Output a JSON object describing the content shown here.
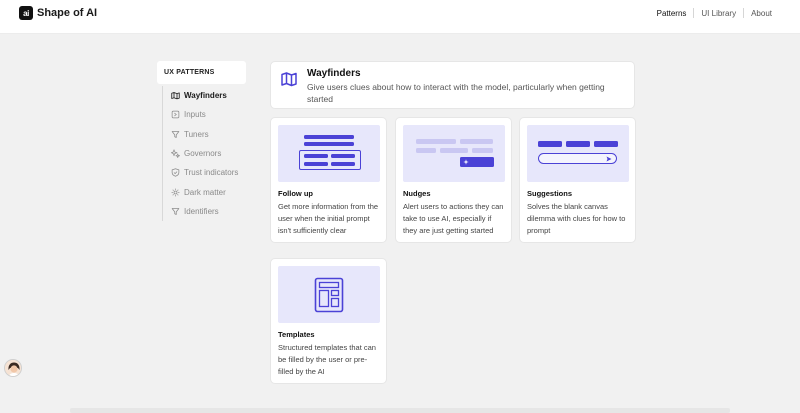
{
  "header": {
    "brand": "Shape of AI",
    "logo_mark": "ai",
    "nav": [
      "Patterns",
      "UI Library",
      "About"
    ]
  },
  "sidebar": {
    "heading": "UX PATTERNS",
    "items": [
      {
        "label": "Wayfinders",
        "icon": "map-icon",
        "active": true
      },
      {
        "label": "Inputs",
        "icon": "input-icon",
        "active": false
      },
      {
        "label": "Tuners",
        "icon": "funnel-icon",
        "active": false
      },
      {
        "label": "Governors",
        "icon": "sparkle-icon",
        "active": false
      },
      {
        "label": "Trust indicators",
        "icon": "shield-icon",
        "active": false
      },
      {
        "label": "Dark matter",
        "icon": "gear-icon",
        "active": false
      },
      {
        "label": "Identifiers",
        "icon": "funnel-icon",
        "active": false
      }
    ]
  },
  "hero": {
    "title": "Wayfinders",
    "description": "Give users clues about how to interact with the model, particularly when getting started",
    "icon": "map-icon"
  },
  "patterns": [
    {
      "title": "Follow up",
      "description": "Get more information from the user when the initial prompt isn't sufficiently clear"
    },
    {
      "title": "Nudges",
      "description": "Alert users to actions they can take to use AI, especially if they are just getting started"
    },
    {
      "title": "Suggestions",
      "description": "Solves the blank canvas dilemma with clues for how to prompt"
    },
    {
      "title": "Templates",
      "description": "Structured templates that can be filled by the user or pre-filled by the AI"
    }
  ],
  "colors": {
    "accent": "#4b42d6",
    "accent_light": "#c9c7f2",
    "thumb_bg": "#e7e7fb",
    "page_bg": "#f1f1f1"
  }
}
